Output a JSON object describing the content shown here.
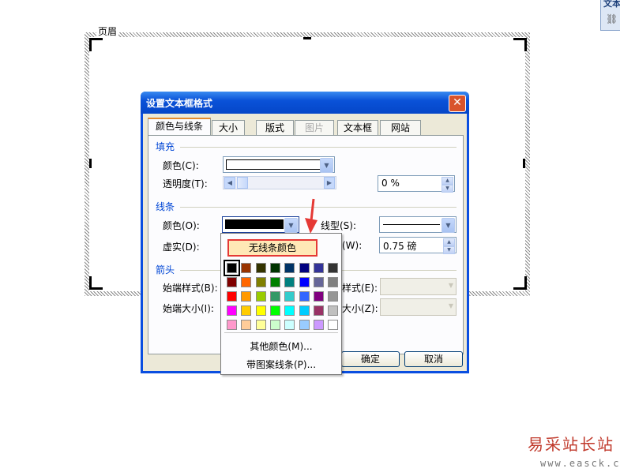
{
  "document": {
    "header_label": "页眉"
  },
  "toolbar_fragment": {
    "title_char": "文本",
    "icon": "link-icon"
  },
  "dialog": {
    "title": "设置文本框格式",
    "close_glyph": "✕",
    "tabs": [
      {
        "label": "颜色与线条",
        "state": "active"
      },
      {
        "label": "大小",
        "state": "normal"
      },
      {
        "label": "版式",
        "state": "normal"
      },
      {
        "label": "图片",
        "state": "disabled"
      },
      {
        "label": "文本框",
        "state": "normal"
      },
      {
        "label": "网站",
        "state": "normal"
      }
    ],
    "fill": {
      "section_label": "填充",
      "color_label": "颜色(C):",
      "color_value": "#ffffff",
      "transparency_label": "透明度(T):",
      "transparency_value": "0 %"
    },
    "line": {
      "section_label": "线条",
      "color_label": "颜色(O):",
      "color_value": "#000000",
      "style_label": "线型(S):",
      "dash_label": "虚实(D):",
      "weight_label": "粗细(W):",
      "weight_short": "(W):",
      "weight_value": "0.75 磅"
    },
    "arrows": {
      "section_label": "箭头",
      "begin_style_label": "始端样式(B):",
      "begin_size_label": "始端大小(I):",
      "end_style_label_short": "样式(E):",
      "end_size_label_short": "大小(Z):"
    },
    "buttons": {
      "ok": "确定",
      "cancel": "取消"
    }
  },
  "color_popup": {
    "no_line_label": "无线条颜色",
    "more_colors_label": "其他颜色(M)...",
    "patterned_lines_label": "带图案线条(P)...",
    "palette": [
      [
        "#000000",
        "#993300",
        "#333300",
        "#003300",
        "#003366",
        "#000080",
        "#333399",
        "#333333"
      ],
      [
        "#800000",
        "#ff6600",
        "#808000",
        "#008000",
        "#008080",
        "#0000ff",
        "#666699",
        "#808080"
      ],
      [
        "#ff0000",
        "#ff9900",
        "#99cc00",
        "#339966",
        "#33cccc",
        "#3366ff",
        "#800080",
        "#969696"
      ],
      [
        "#ff00ff",
        "#ffcc00",
        "#ffff00",
        "#00ff00",
        "#00ffff",
        "#00ccff",
        "#993366",
        "#c0c0c0"
      ],
      [
        "#ff99cc",
        "#ffcc99",
        "#ffff99",
        "#ccffcc",
        "#ccffff",
        "#99ccff",
        "#cc99ff",
        "#ffffff"
      ]
    ],
    "selected_swatch": "#000000"
  },
  "watermark": {
    "name": "易采站长站",
    "url": "www.easck.com"
  },
  "colors": {
    "accent_red": "#e53935",
    "title_blue": "#0a52d8",
    "section_blue": "#0046d5"
  }
}
